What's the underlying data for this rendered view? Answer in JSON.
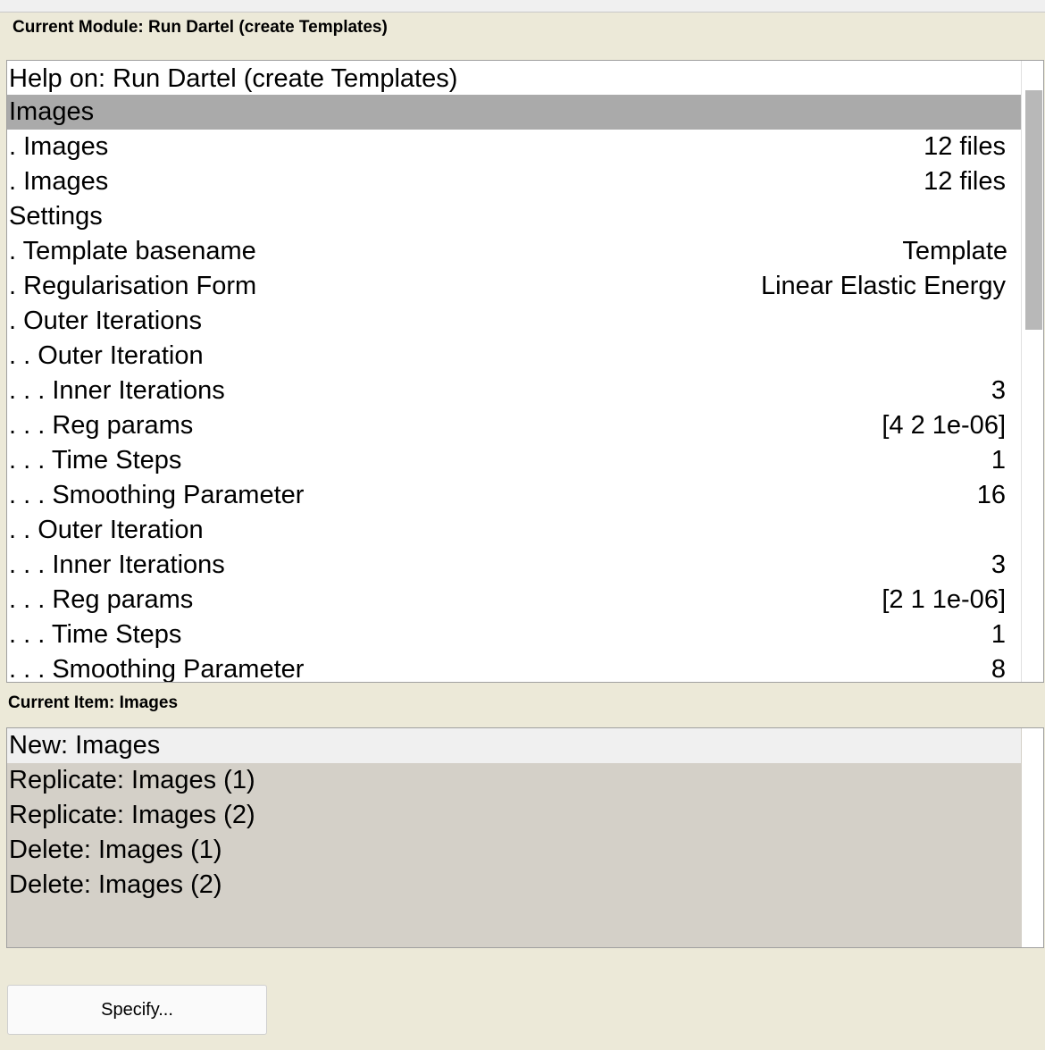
{
  "current_module_label": "Current Module: Run Dartel (create Templates)",
  "current_item_label": "Current Item: Images",
  "module_list": {
    "help_row": "Help on: Run Dartel (create Templates)",
    "rows": [
      {
        "label": "Images",
        "value": ""
      },
      {
        "label": ". Images",
        "value": "12 files"
      },
      {
        "label": ". Images",
        "value": "12 files"
      },
      {
        "label": "Settings",
        "value": ""
      },
      {
        "label": ". Template basename",
        "value": "Template"
      },
      {
        "label": ". Regularisation Form",
        "value": "Linear Elastic Energy"
      },
      {
        "label": ". Outer Iterations",
        "value": ""
      },
      {
        "label": ". . Outer Iteration",
        "value": ""
      },
      {
        "label": ". . . Inner Iterations",
        "value": "3"
      },
      {
        "label": ". . . Reg params",
        "value": "[4 2 1e-06]"
      },
      {
        "label": ". . . Time Steps",
        "value": "1"
      },
      {
        "label": ". . . Smoothing Parameter",
        "value": "16"
      },
      {
        "label": ". . Outer Iteration",
        "value": ""
      },
      {
        "label": ". . . Inner Iterations",
        "value": "3"
      },
      {
        "label": ". . . Reg params",
        "value": "[2 1 1e-06]"
      },
      {
        "label": ". . . Time Steps",
        "value": "1"
      },
      {
        "label": ". . . Smoothing Parameter",
        "value": "8"
      }
    ]
  },
  "options": [
    "New: Images",
    "Replicate: Images (1)",
    "Replicate: Images (2)",
    "Delete: Images (1)",
    "Delete: Images (2)"
  ],
  "specify_button": "Specify..."
}
